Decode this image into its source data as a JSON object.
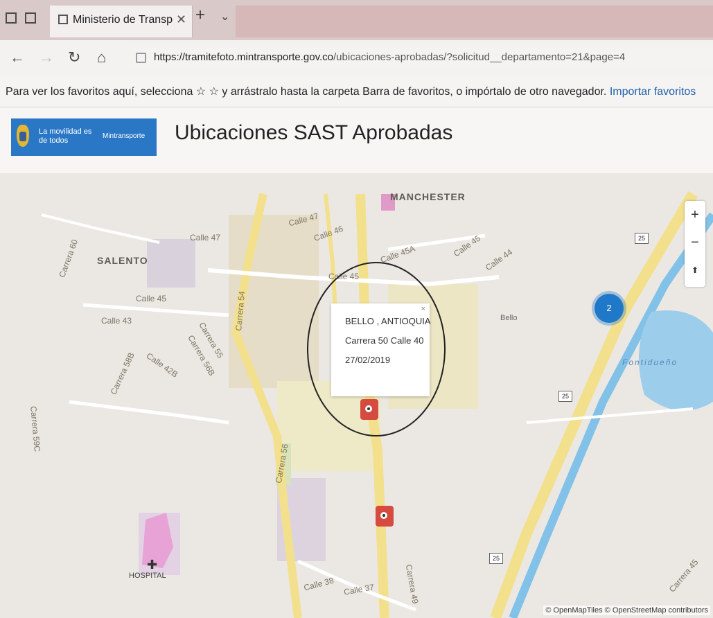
{
  "browser": {
    "tab_title": "Ministerio de Transporte",
    "tab_close": "✕",
    "new_tab": "+",
    "tab_menu": "⌄",
    "url_host": "https://tramitefoto.mintransporte.gov.co",
    "url_path": "/ubicaciones-aprobadas/?solicitud__departamento=21&page=4",
    "nav": {
      "back": "←",
      "forward": "→",
      "refresh": "↻",
      "home": "⌂"
    },
    "favorites_text": "Para ver los favoritos aquí, selecciona ☆ ☆ y arrástralo hasta la carpeta Barra de favoritos, o impórtalo de otro navegador.",
    "favorites_link": "Importar favoritos"
  },
  "header": {
    "logo_slogan": "La movilidad es de todos",
    "logo_brand": "Mintransporte",
    "title": "Ubicaciones SAST Aprobadas"
  },
  "map": {
    "zoom_in": "+",
    "zoom_out": "−",
    "compass": "⬆",
    "cluster_count": "2",
    "popup": {
      "location": "BELLO , ANTIOQUIA",
      "address": "Carrera 50 Calle 40",
      "date": "27/02/2019",
      "close": "×"
    },
    "places": {
      "salento": "SALENTO",
      "manchester": "MANCHESTER",
      "bello": "Bello",
      "hospital": "HOSPITAL",
      "water": "Fontidueño"
    },
    "streets": [
      "Calle 47",
      "Calle 46",
      "Calle 47",
      "Calle 45A",
      "Calle 45",
      "Calle 44",
      "Calle 45",
      "Calle 45",
      "Calle 43",
      "Carrera 60",
      "Carrera 54",
      "Carrera 55",
      "Carrera 56B",
      "Calle 42B",
      "Carrera 58B",
      "Carrera 59C",
      "Carrera 56",
      "Calle 38",
      "Calle 37",
      "Carrera 49",
      "Carrera 45"
    ],
    "route_shield": "25",
    "attribution": "© OpenMapTiles © OpenStreetMap contributors"
  }
}
